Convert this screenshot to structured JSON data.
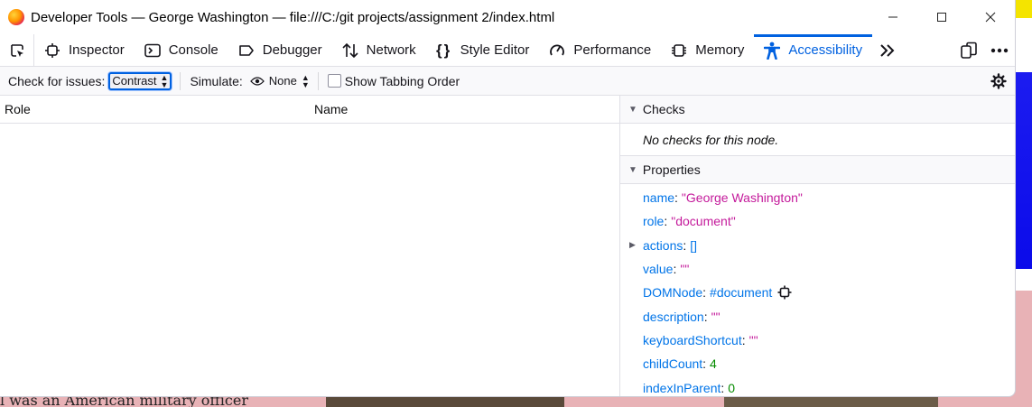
{
  "window": {
    "title": "Developer Tools — George Washington — file:///C:/git projects/assignment 2/index.html"
  },
  "tabs": [
    {
      "label": "Inspector",
      "icon": "inspector-icon"
    },
    {
      "label": "Console",
      "icon": "console-icon"
    },
    {
      "label": "Debugger",
      "icon": "debugger-icon"
    },
    {
      "label": "Network",
      "icon": "network-icon"
    },
    {
      "label": "Style Editor",
      "icon": "style-editor-icon"
    },
    {
      "label": "Performance",
      "icon": "performance-icon"
    },
    {
      "label": "Memory",
      "icon": "memory-icon"
    },
    {
      "label": "Accessibility",
      "icon": "accessibility-icon",
      "active": true
    }
  ],
  "toolbar": {
    "check_label": "Check for issues:",
    "check_value": "Contrast",
    "simulate_label": "Simulate:",
    "simulate_value": "None",
    "tabbing_label": "Show Tabbing Order"
  },
  "tree": {
    "col_role": "Role",
    "col_name": "Name"
  },
  "checks": {
    "title": "Checks",
    "empty": "No checks for this node."
  },
  "properties": {
    "title": "Properties",
    "items": [
      {
        "key": "name",
        "value": "\"George Washington\"",
        "type": "str"
      },
      {
        "key": "role",
        "value": "\"document\"",
        "type": "str"
      },
      {
        "key": "actions",
        "value": "[]",
        "type": "obj",
        "expandable": true
      },
      {
        "key": "value",
        "value": "\"\"",
        "type": "str"
      },
      {
        "key": "DOMNode",
        "value": "#document",
        "type": "obj"
      },
      {
        "key": "description",
        "value": "\"\"",
        "type": "str"
      },
      {
        "key": "keyboardShortcut",
        "value": "\"\"",
        "type": "str"
      },
      {
        "key": "childCount",
        "value": "4",
        "type": "num"
      },
      {
        "key": "indexInParent",
        "value": "0",
        "type": "num"
      }
    ]
  },
  "background_page": {
    "text": "l was an American military officer"
  },
  "colors": {
    "accent": "#0061e0",
    "string": "#c41a9b",
    "number": "#058b00",
    "key": "#0074e8"
  }
}
